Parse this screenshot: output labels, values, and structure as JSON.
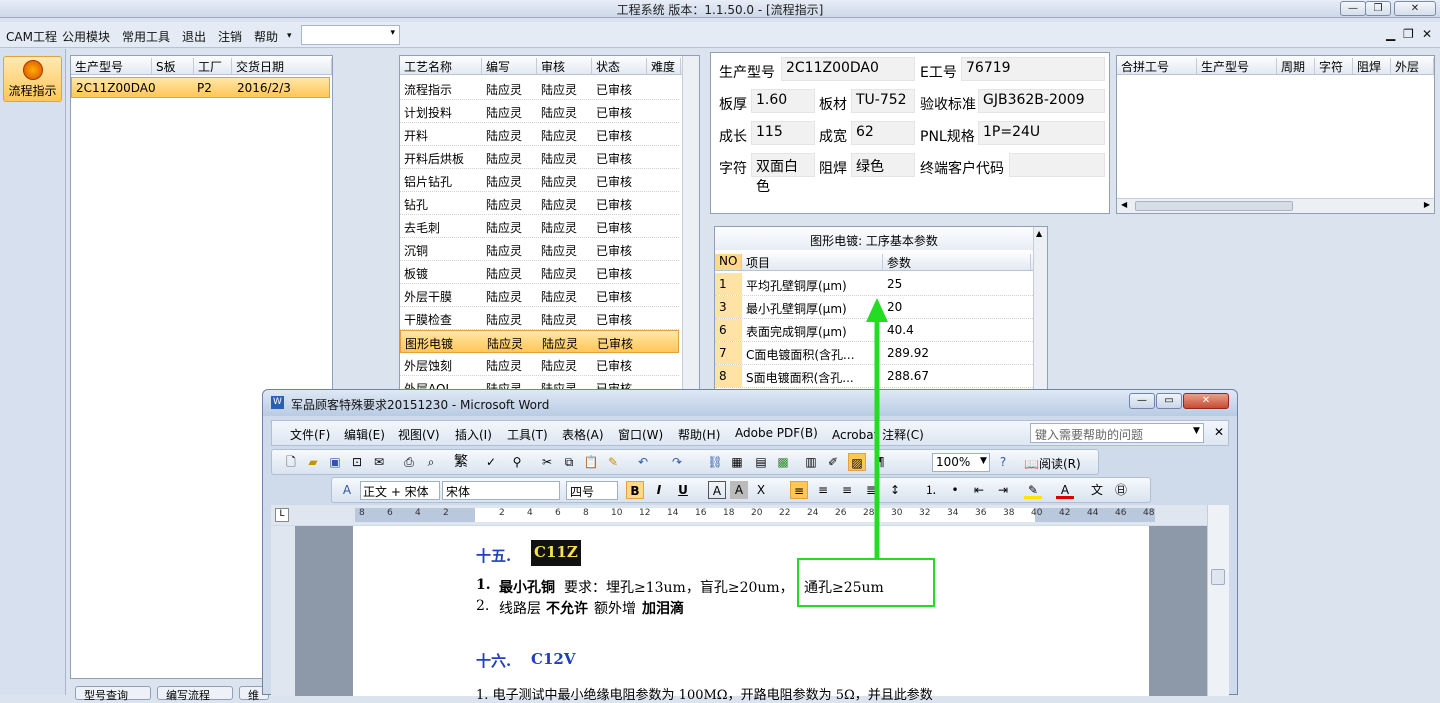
{
  "app": {
    "title": "工程系统   版本：1.1.50.0 - [流程指示]"
  },
  "menubar": {
    "items": [
      "CAM工程",
      "公用模块",
      "常用工具",
      "退出",
      "注销",
      "帮助",
      "▾"
    ]
  },
  "sidebar": {
    "item_label": "流程指示"
  },
  "orders": {
    "headers": [
      "生产型号",
      "S板",
      "工厂",
      "交货日期"
    ],
    "rows": [
      [
        "2C11Z00DA0",
        "",
        "P2",
        "2016/2/3"
      ]
    ]
  },
  "processes": {
    "headers": [
      "工艺名称",
      "编写",
      "审核",
      "状态",
      "难度"
    ],
    "rows": [
      [
        "流程指示",
        "陆应灵",
        "陆应灵",
        "已审核",
        ""
      ],
      [
        "计划投料",
        "陆应灵",
        "陆应灵",
        "已审核",
        ""
      ],
      [
        "开料",
        "陆应灵",
        "陆应灵",
        "已审核",
        ""
      ],
      [
        "开料后烘板",
        "陆应灵",
        "陆应灵",
        "已审核",
        ""
      ],
      [
        "铝片钻孔",
        "陆应灵",
        "陆应灵",
        "已审核",
        ""
      ],
      [
        "钻孔",
        "陆应灵",
        "陆应灵",
        "已审核",
        ""
      ],
      [
        "去毛刺",
        "陆应灵",
        "陆应灵",
        "已审核",
        ""
      ],
      [
        "沉铜",
        "陆应灵",
        "陆应灵",
        "已审核",
        ""
      ],
      [
        "板镀",
        "陆应灵",
        "陆应灵",
        "已审核",
        ""
      ],
      [
        "外层干膜",
        "陆应灵",
        "陆应灵",
        "已审核",
        ""
      ],
      [
        "干膜检查",
        "陆应灵",
        "陆应灵",
        "已审核",
        ""
      ],
      [
        "图形电镀",
        "陆应灵",
        "陆应灵",
        "已审核",
        ""
      ],
      [
        "外层蚀刻",
        "陆应灵",
        "陆应灵",
        "已审核",
        ""
      ],
      [
        "外层AOI",
        "陆应灵",
        "陆应灵",
        "已审核",
        ""
      ]
    ],
    "selected_index": 11
  },
  "product": {
    "model_label": "生产型号",
    "model": "2C11Z00DA0",
    "eno_label": "E工号",
    "eno": "76719",
    "thickness_label": "板厚",
    "thickness": "1.60",
    "material_label": "板材",
    "material": "TU-752",
    "standard_label": "验收标准",
    "standard": "GJB362B-2009",
    "length_label": "成长",
    "length": "115",
    "width_label": "成宽",
    "width": "62",
    "pnl_label": "PNL规格",
    "pnl": "1P=24U",
    "legend_label": "字符",
    "legend": "双面白色",
    "mask_label": "阻焊",
    "mask": "绿色",
    "customer_label": "终端客户代码",
    "customer": ""
  },
  "merge": {
    "headers": [
      "合拼工号",
      "生产型号",
      "周期",
      "字符",
      "阻焊",
      "外层"
    ]
  },
  "params": {
    "title": "图形电镀: 工序基本参数",
    "headers": [
      "NO",
      "项目",
      "参数"
    ],
    "rows": [
      [
        "1",
        "平均孔壁铜厚(μm)",
        "25"
      ],
      [
        "3",
        "最小孔壁铜厚(μm)",
        "20"
      ],
      [
        "6",
        "表面完成铜厚(μm)",
        "40.4"
      ],
      [
        "7",
        "C面电镀面积(含孔...",
        "289.92"
      ],
      [
        "8",
        "S面电镀面积(含孔...",
        "288.67"
      ]
    ]
  },
  "bottom_buttons": [
    "型号查询",
    "编写流程",
    "维"
  ],
  "word": {
    "title": "军品顾客特殊要求20151230 - Microsoft Word",
    "menus": [
      "文件(F)",
      "编辑(E)",
      "视图(V)",
      "插入(I)",
      "工具(T)",
      "表格(A)",
      "窗口(W)",
      "帮助(H)",
      "Adobe PDF(B)",
      "Acrobat 注释(C)"
    ],
    "help_placeholder": "键入需要帮助的问题",
    "zoom": "100%",
    "read_label": "阅读(R)",
    "style": "正文 + 宋体",
    "font": "宋体",
    "size": "四号",
    "ruler": [
      "8",
      "6",
      "4",
      "2",
      "2",
      "4",
      "6",
      "8",
      "10",
      "12",
      "14",
      "16",
      "18",
      "20",
      "22",
      "24",
      "26",
      "28",
      "30",
      "32",
      "34",
      "36",
      "38",
      "40",
      "42",
      "44",
      "46",
      "48"
    ],
    "doc": {
      "h15_num": "十五.",
      "h15_code": "C11Z",
      "item1_num": "1.",
      "item1_bold": "最小孔铜",
      "item1_text": "要求：埋孔≥13um，盲孔≥20um，",
      "item1_hl": "通孔≥25um",
      "item2_num": "2.",
      "item2_a": "线路层",
      "item2_b": "不允许",
      "item2_c": "额外增",
      "item2_d": "加泪滴",
      "h16_num": "十六.",
      "h16_code": "C12V",
      "item3": "1. 电子测试中最小绝缘电阻参数为 100MΩ，开路电阻参数为 5Ω，并且此参数"
    }
  },
  "colors": {
    "accent": "#ffc658",
    "annotation": "#22dd22",
    "heading": "#1f3fbf"
  }
}
